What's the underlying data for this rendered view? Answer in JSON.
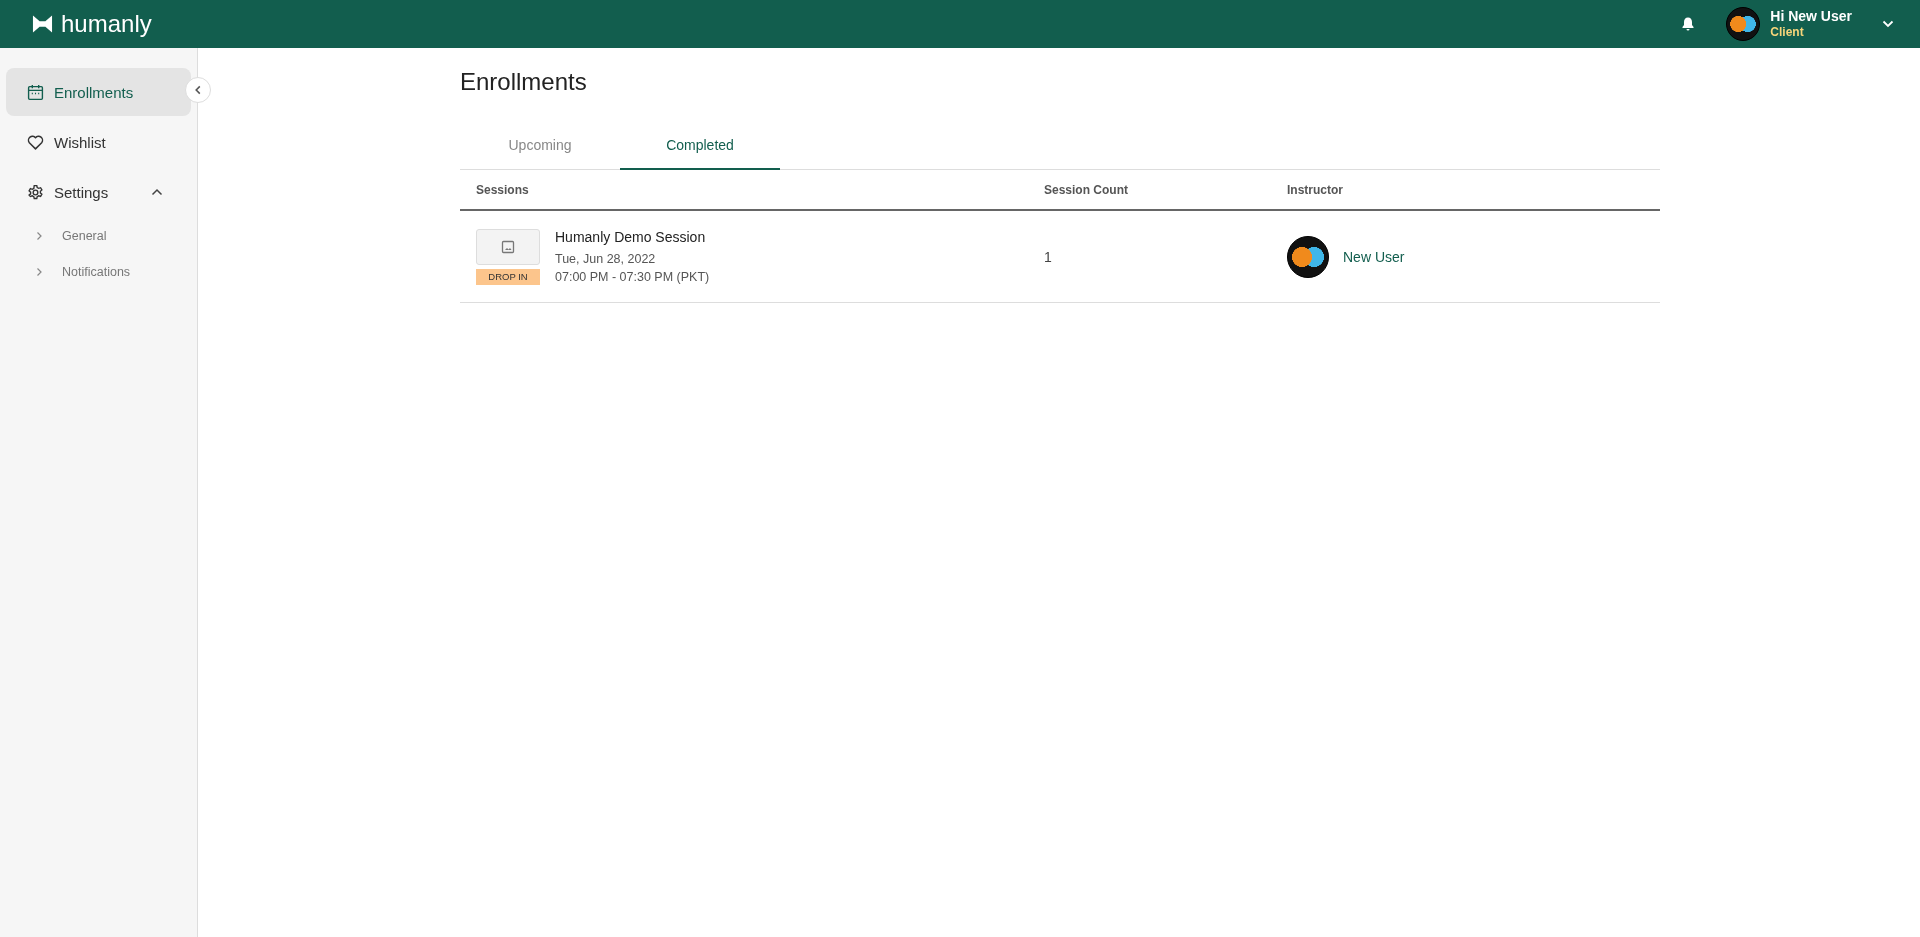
{
  "header": {
    "brand": "humanly",
    "user": {
      "greeting": "Hi New User",
      "role": "Client"
    }
  },
  "sidebar": {
    "items": [
      {
        "label": "Enrollments",
        "kind": "calendar",
        "selected": true
      },
      {
        "label": "Wishlist",
        "kind": "heart",
        "selected": false
      },
      {
        "label": "Settings",
        "kind": "gear",
        "selected": false,
        "expanded": true,
        "children": [
          {
            "label": "General"
          },
          {
            "label": "Notifications"
          }
        ]
      }
    ]
  },
  "page": {
    "title": "Enrollments"
  },
  "tabs": [
    {
      "label": "Upcoming",
      "selected": false
    },
    {
      "label": "Completed",
      "selected": true
    }
  ],
  "table": {
    "columns": [
      "Sessions",
      "Session Count",
      "Instructor"
    ],
    "rows": [
      {
        "title": "Humanly Demo Session",
        "date": "Tue, Jun 28, 2022",
        "time": "07:00 PM - 07:30 PM (PKT)",
        "badge": "DROP IN",
        "count": "1",
        "instructor": "New User"
      }
    ]
  }
}
